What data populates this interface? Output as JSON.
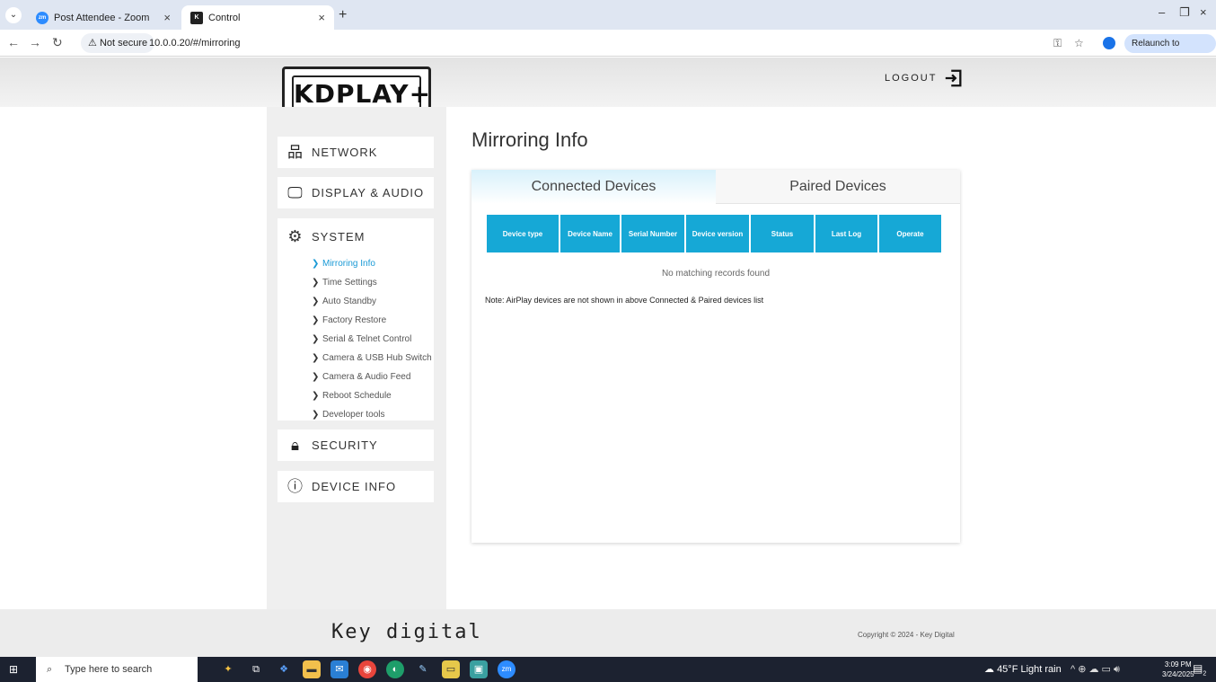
{
  "browser": {
    "tabs": [
      {
        "label": "Post Attendee - Zoom",
        "favicon": "zoom-icon"
      },
      {
        "label": "Control",
        "favicon": "key-digital-icon"
      }
    ],
    "new_tab": "+",
    "security_label": "Not secure",
    "url": "10.0.0.20/#/mirroring",
    "relaunch_label": "Relaunch to update"
  },
  "header": {
    "logo_text": "KDPLAY+",
    "logout_label": "LOGOUT"
  },
  "sidebar": {
    "network": "NETWORK",
    "display_audio": "DISPLAY & AUDIO",
    "system": "SYSTEM",
    "system_items": [
      {
        "label": "Mirroring Info",
        "active": true
      },
      {
        "label": "Time Settings"
      },
      {
        "label": "Auto Standby"
      },
      {
        "label": "Factory Restore"
      },
      {
        "label": "Serial & Telnet Control"
      },
      {
        "label": "Camera & USB Hub Switch"
      },
      {
        "label": "Camera & Audio Feed"
      },
      {
        "label": "Reboot Schedule"
      },
      {
        "label": "Developer tools"
      }
    ],
    "security": "SECURITY",
    "device_info": "DEVICE INFO"
  },
  "main": {
    "title": "Mirroring Info",
    "tabs": [
      {
        "label": "Connected Devices",
        "active": true
      },
      {
        "label": "Paired Devices"
      }
    ],
    "table": {
      "columns": [
        "Device type",
        "Device Name",
        "Serial Number",
        "Device version",
        "Status",
        "Last Log",
        "Operate"
      ],
      "empty_text": "No matching records found"
    },
    "note": "Note: AirPlay devices are not shown in above Connected & Paired devices list"
  },
  "footer": {
    "brand": "Key digital",
    "copyright": "Copyright © 2024 - Key Digital"
  },
  "taskbar": {
    "search_placeholder": "Type here to search",
    "weather": "45°F  Light rain",
    "time": "3:09 PM",
    "date": "3/24/2025",
    "notification_count": "2"
  },
  "colors": {
    "accent": "#16a8d6",
    "active_link": "#1a9ad6",
    "sidebar_bg": "#efefef",
    "taskbar_bg": "#1c2230"
  }
}
